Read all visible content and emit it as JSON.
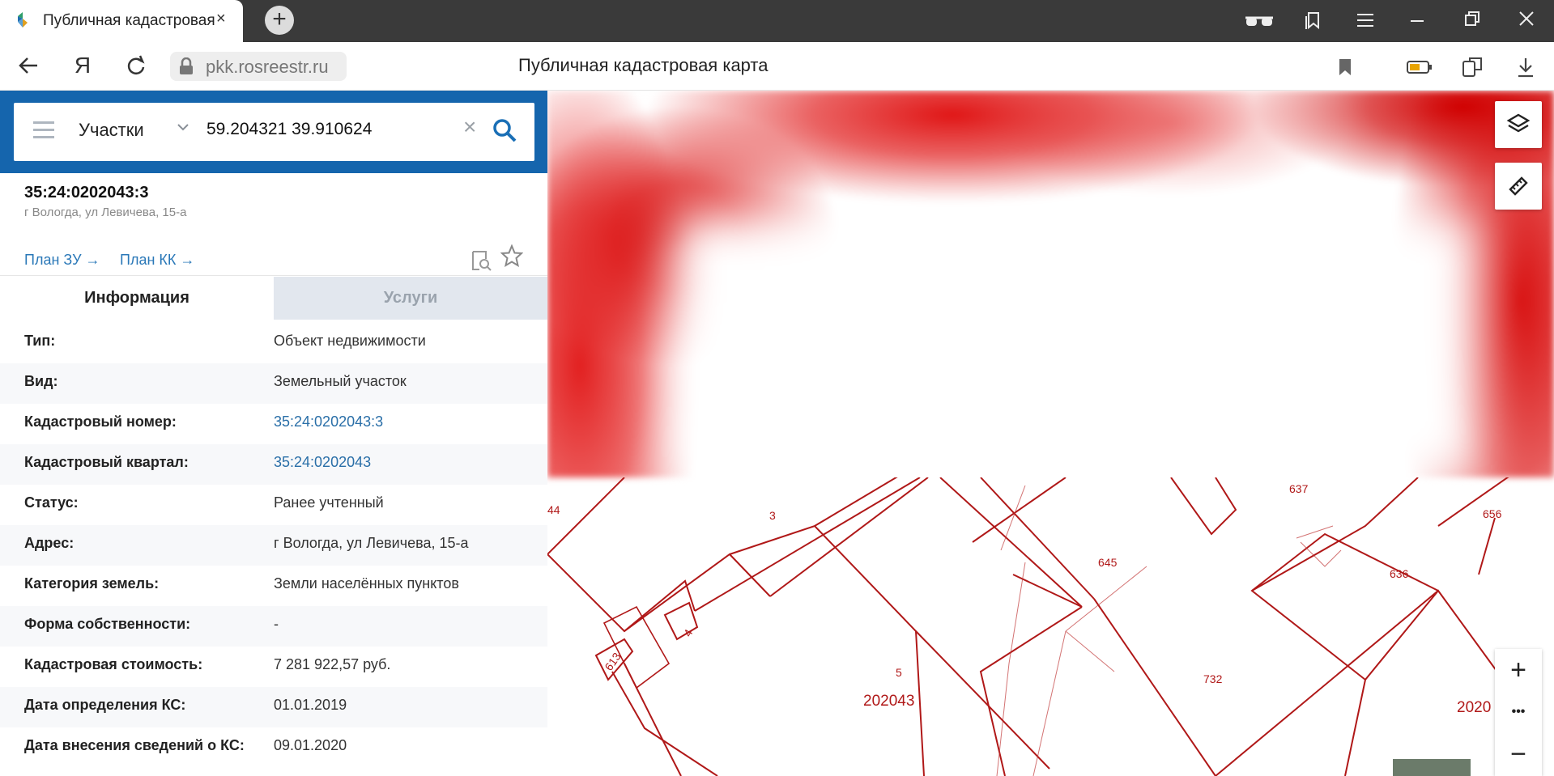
{
  "browser": {
    "tab_title": "Публичная кадастровая",
    "tab_close": "×",
    "new_tab": "+",
    "url": "pkk.rosreestr.ru",
    "page_title": "Публичная кадастровая карта",
    "back": "←",
    "yandex": "Я",
    "reload": "↻"
  },
  "search": {
    "layer": "Участки",
    "query": "59.204321 39.910624",
    "clear": "×"
  },
  "parcel": {
    "number": "35:24:0202043:3",
    "address": "г Вологда, ул Левичева, 15-а",
    "plan_zu": "План ЗУ →",
    "plan_kk": "План КК →"
  },
  "tabs": {
    "info": "Информация",
    "services": "Услуги"
  },
  "info_rows": [
    {
      "key": "Тип:",
      "value": "Объект недвижимости"
    },
    {
      "key": "Вид:",
      "value": "Земельный участок"
    },
    {
      "key": "Кадастровый номер:",
      "value": "35:24:0202043:3"
    },
    {
      "key": "Кадастровый квартал:",
      "value": "35:24:0202043"
    },
    {
      "key": "Статус:",
      "value": "Ранее учтенный"
    },
    {
      "key": "Адрес:",
      "value": "г Вологда, ул Левичева, 15-а"
    },
    {
      "key": "Категория земель:",
      "value": "Земли населённых пунктов"
    },
    {
      "key": "Форма собственности:",
      "value": "-"
    },
    {
      "key": "Кадастровая стоимость:",
      "value": "7 281 922,57 руб."
    },
    {
      "key": "Дата определения КС:",
      "value": "01.01.2019"
    },
    {
      "key": "Дата внесения сведений о КС:",
      "value": "09.01.2020"
    }
  ],
  "map_labels": {
    "l44": "44",
    "l3": "3",
    "l637": "637",
    "l656": "656",
    "l645": "645",
    "l636": "636",
    "l4": "4",
    "l613": "613",
    "l5": "5",
    "l732": "732",
    "quarter": "202043",
    "quarter2": "2020"
  },
  "map_controls": {
    "zoom_in": "+",
    "more": "•••",
    "zoom_out": "−"
  },
  "colors": {
    "accent": "#1565ad",
    "link": "#2a78b8",
    "cadastral_line": "#b01818"
  }
}
